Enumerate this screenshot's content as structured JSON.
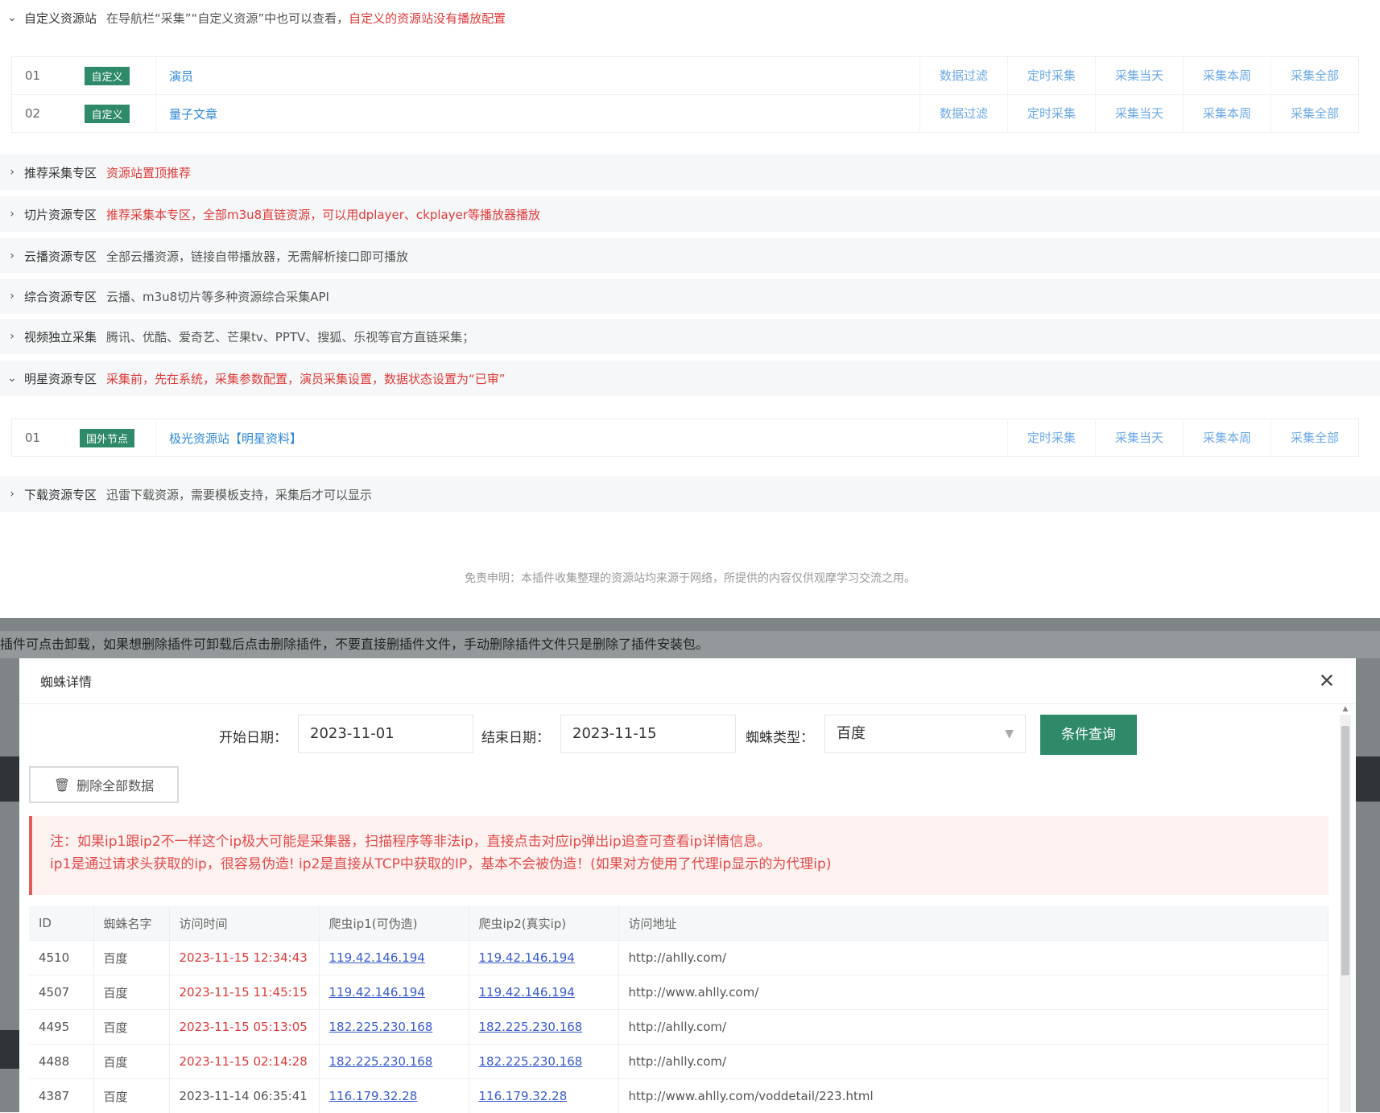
{
  "custom": {
    "title": "自定义资源站",
    "desc": "在导航栏“采集”“自定义资源”中也可以查看，",
    "desc_red": "自定义的资源站没有播放配置",
    "rows": [
      {
        "idx": "01",
        "badge": "自定义",
        "name": "演员",
        "actions": [
          "数据过滤",
          "定时采集",
          "采集当天",
          "采集本周",
          "采集全部"
        ]
      },
      {
        "idx": "02",
        "badge": "自定义",
        "name": "量子文章",
        "actions": [
          "数据过滤",
          "定时采集",
          "采集当天",
          "采集本周",
          "采集全部"
        ]
      }
    ]
  },
  "sections": [
    {
      "title": "推荐采集专区",
      "desc": "资源站置顶推荐",
      "red": true
    },
    {
      "title": "切片资源专区",
      "desc": "推荐采集本专区，全部m3u8直链资源，可以用dplayer、ckplayer等播放器播放",
      "red": true
    },
    {
      "title": "云播资源专区",
      "desc": "全部云播资源，链接自带播放器，无需解析接口即可播放",
      "red": false
    },
    {
      "title": "综合资源专区",
      "desc": "云播、m3u8切片等多种资源综合采集API",
      "red": false
    },
    {
      "title": "视频独立采集",
      "desc": "腾讯、优酷、爱奇艺、芒果tv、PPTV、搜狐、乐视等官方直链采集；",
      "red": false
    }
  ],
  "star": {
    "title": "明星资源专区",
    "desc": "采集前，先在系统，采集参数配置，演员采集设置，数据状态设置为“已审”",
    "rows": [
      {
        "idx": "01",
        "badge": "国外节点",
        "name": "极光资源站【明星资料】",
        "actions": [
          "定时采集",
          "采集当天",
          "采集本周",
          "采集全部"
        ]
      }
    ]
  },
  "download": {
    "title": "下载资源专区",
    "desc": "迅雷下载资源，需要模板支持，采集后才可以显示"
  },
  "disclaimer": "免责申明：本插件收集整理的资源站均来源于网络，所提供的内容仅供观摩学习交流之用。",
  "notice": "插件可点击卸载，如果想删除插件可卸载后点击删除插件，不要直接删插件文件，手动删除插件文件只是删除了插件安装包。",
  "modal": {
    "title": "蜘蛛详情",
    "start_label": "开始日期：",
    "start_value": "2023-11-01",
    "end_label": "结束日期：",
    "end_value": "2023-11-15",
    "type_label": "蜘蛛类型：",
    "type_value": "百度",
    "query_btn": "条件查询",
    "delete_btn": "删除全部数据",
    "warn_line1": "注：如果ip1跟ip2不一样这个ip极大可能是采集器，扫描程序等非法ip，直接点击对应ip弹出ip追查可查看ip详情信息。",
    "warn_line2": "ip1是通过请求头获取的ip，很容易伪造! ip2是直接从TCP中获取的IP，基本不会被伪造！(如果对方使用了代理ip显示的为代理ip)",
    "columns": [
      "ID",
      "蜘蛛名字",
      "访问时间",
      "爬虫ip1(可伪造)",
      "爬虫ip2(真实ip)",
      "访问地址"
    ],
    "rows": [
      {
        "id": "4510",
        "name": "百度",
        "time": "2023-11-15 12:34:43",
        "ip1": "119.42.146.194",
        "ip2": "119.42.146.194",
        "url": "http://ahlly.com/",
        "red": true
      },
      {
        "id": "4507",
        "name": "百度",
        "time": "2023-11-15 11:45:15",
        "ip1": "119.42.146.194",
        "ip2": "119.42.146.194",
        "url": "http://www.ahlly.com/",
        "red": true
      },
      {
        "id": "4495",
        "name": "百度",
        "time": "2023-11-15 05:13:05",
        "ip1": "182.225.230.168",
        "ip2": "182.225.230.168",
        "url": "http://ahlly.com/",
        "red": true
      },
      {
        "id": "4488",
        "name": "百度",
        "time": "2023-11-15 02:14:28",
        "ip1": "182.225.230.168",
        "ip2": "182.225.230.168",
        "url": "http://ahlly.com/",
        "red": true
      },
      {
        "id": "4387",
        "name": "百度",
        "time": "2023-11-14 06:35:41",
        "ip1": "116.179.32.28",
        "ip2": "116.179.32.28",
        "url": "http://www.ahlly.com/voddetail/223.html",
        "red": false
      }
    ]
  },
  "colors": {
    "accent": "#2f8a6a",
    "link": "#2f87d8",
    "danger": "#e03a3a"
  }
}
